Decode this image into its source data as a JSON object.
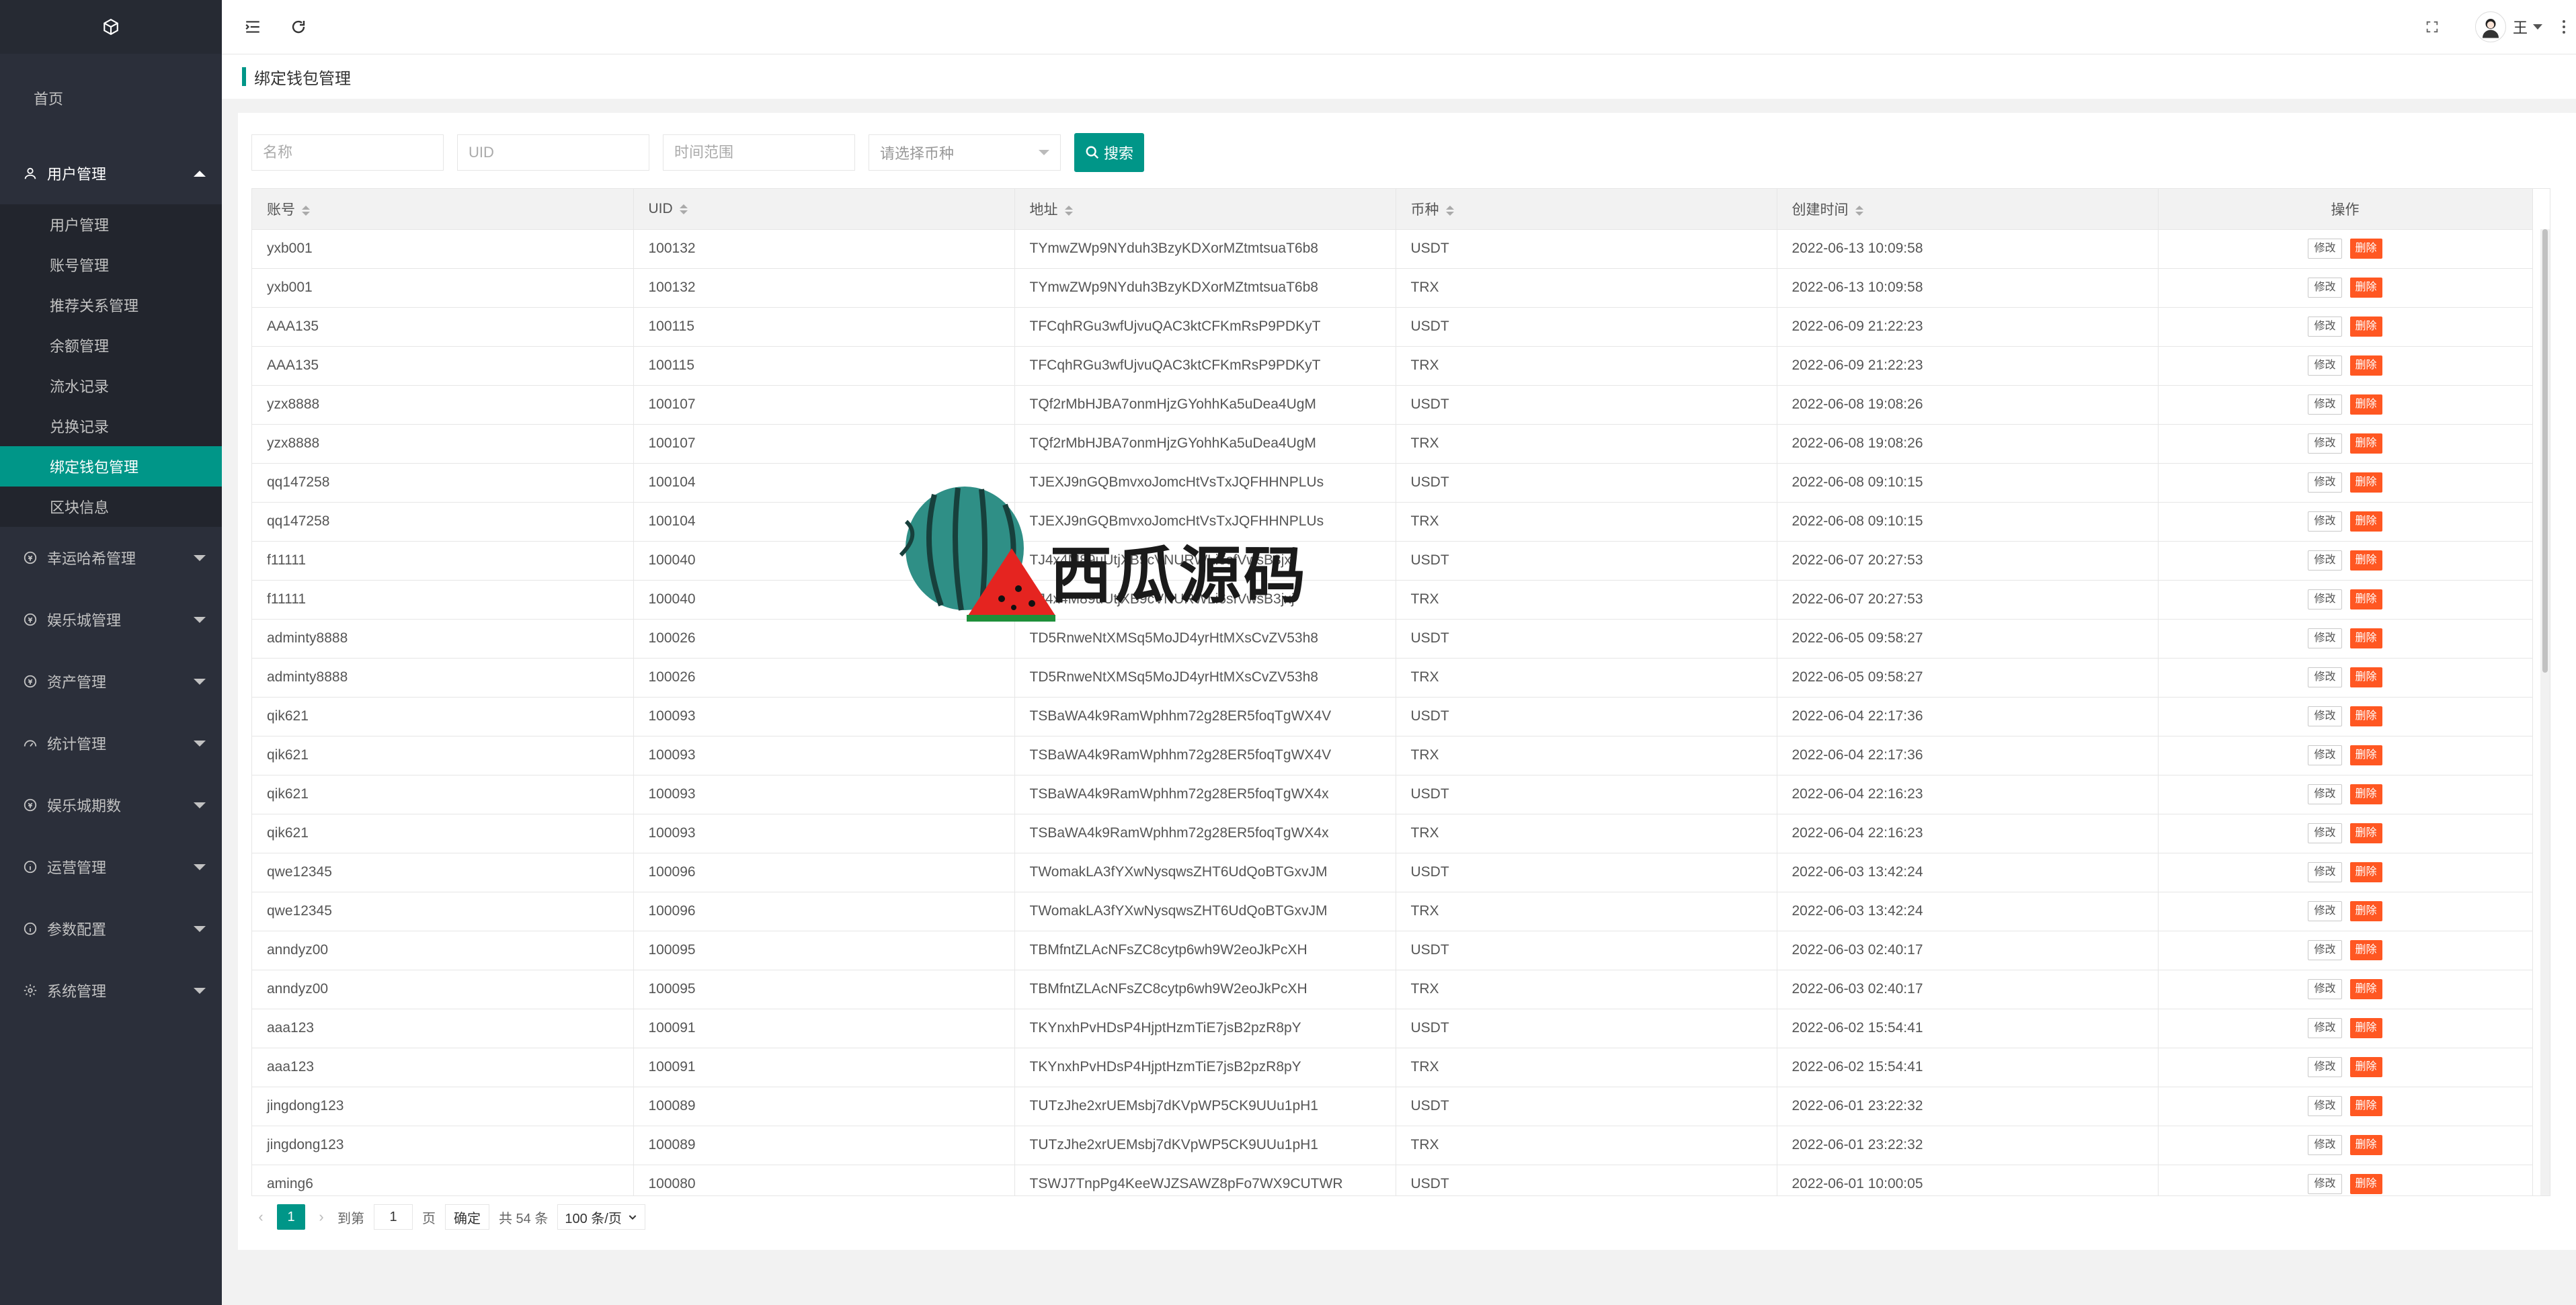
{
  "sidebar": {
    "home": "首页",
    "groups": [
      {
        "label": "用户管理",
        "icon": "user-icon",
        "open": true,
        "children": [
          "用户管理",
          "账号管理",
          "推荐关系管理",
          "余额管理",
          "流水记录",
          "兑换记录",
          "绑定钱包管理",
          "区块信息"
        ]
      },
      {
        "label": "幸运哈希管理",
        "icon": "coin-icon"
      },
      {
        "label": "娱乐城管理",
        "icon": "coin-icon"
      },
      {
        "label": "资产管理",
        "icon": "coin-icon"
      },
      {
        "label": "统计管理",
        "icon": "gauge-icon"
      },
      {
        "label": "娱乐城期数",
        "icon": "coin-icon"
      },
      {
        "label": "运营管理",
        "icon": "info-icon"
      },
      {
        "label": "参数配置",
        "icon": "info-icon"
      },
      {
        "label": "系统管理",
        "icon": "gear-icon"
      }
    ],
    "active_child": "绑定钱包管理"
  },
  "header": {
    "user_name": "王"
  },
  "page": {
    "title": "绑定钱包管理"
  },
  "filters": {
    "name_placeholder": "名称",
    "uid_placeholder": "UID",
    "time_placeholder": "时间范围",
    "coin_placeholder": "请选择币种",
    "search_label": "搜索"
  },
  "table": {
    "columns": [
      "账号",
      "UID",
      "地址",
      "币种",
      "创建时间",
      "操作"
    ],
    "edit_label": "修改",
    "delete_label": "删除",
    "rows": [
      [
        "yxb001",
        "100132",
        "TYmwZWp9NYduh3BzyKDXorMZtmtsuaT6b8",
        "USDT",
        "2022-06-13 10:09:58"
      ],
      [
        "yxb001",
        "100132",
        "TYmwZWp9NYduh3BzyKDXorMZtmtsuaT6b8",
        "TRX",
        "2022-06-13 10:09:58"
      ],
      [
        "AAA135",
        "100115",
        "TFCqhRGu3wfUjvuQAC3ktCFKmRsP9PDKyT",
        "USDT",
        "2022-06-09 21:22:23"
      ],
      [
        "AAA135",
        "100115",
        "TFCqhRGu3wfUjvuQAC3ktCFKmRsP9PDKyT",
        "TRX",
        "2022-06-09 21:22:23"
      ],
      [
        "yzx8888",
        "100107",
        "TQf2rMbHJBA7onmHjzGYohhKa5uDea4UgM",
        "USDT",
        "2022-06-08 19:08:26"
      ],
      [
        "yzx8888",
        "100107",
        "TQf2rMbHJBA7onmHjzGYohhKa5uDea4UgM",
        "TRX",
        "2022-06-08 19:08:26"
      ],
      [
        "qq147258",
        "100104",
        "TJEXJ9nGQBmvxoJomcHtVsTxJQFHHNPLUs",
        "USDT",
        "2022-06-08 09:10:15"
      ],
      [
        "qq147258",
        "100104",
        "TJEXJ9nGQBmvxoJomcHtVsTxJQFHHNPLUs",
        "TRX",
        "2022-06-08 09:10:15"
      ],
      [
        "f11111",
        "100040",
        "TJ4x4M89uUtjXB9cVNURWLi6sfVwsB3jxj",
        "USDT",
        "2022-06-07 20:27:53"
      ],
      [
        "f11111",
        "100040",
        "TJ4x4M89uUtjXB9cVNURWLi6sfVwsB3jxj",
        "TRX",
        "2022-06-07 20:27:53"
      ],
      [
        "adminty8888",
        "100026",
        "TD5RnweNtXMSq5MoJD4yrHtMXsCvZV53h8",
        "USDT",
        "2022-06-05 09:58:27"
      ],
      [
        "adminty8888",
        "100026",
        "TD5RnweNtXMSq5MoJD4yrHtMXsCvZV53h8",
        "TRX",
        "2022-06-05 09:58:27"
      ],
      [
        "qik621",
        "100093",
        "TSBaWA4k9RamWphhm72g28ER5foqTgWX4V",
        "USDT",
        "2022-06-04 22:17:36"
      ],
      [
        "qik621",
        "100093",
        "TSBaWA4k9RamWphhm72g28ER5foqTgWX4V",
        "TRX",
        "2022-06-04 22:17:36"
      ],
      [
        "qik621",
        "100093",
        "TSBaWA4k9RamWphhm72g28ER5foqTgWX4x",
        "USDT",
        "2022-06-04 22:16:23"
      ],
      [
        "qik621",
        "100093",
        "TSBaWA4k9RamWphhm72g28ER5foqTgWX4x",
        "TRX",
        "2022-06-04 22:16:23"
      ],
      [
        "qwe12345",
        "100096",
        "TWomakLA3fYXwNysqwsZHT6UdQoBTGxvJM",
        "USDT",
        "2022-06-03 13:42:24"
      ],
      [
        "qwe12345",
        "100096",
        "TWomakLA3fYXwNysqwsZHT6UdQoBTGxvJM",
        "TRX",
        "2022-06-03 13:42:24"
      ],
      [
        "anndyz00",
        "100095",
        "TBMfntZLAcNFsZC8cytp6wh9W2eoJkPcXH",
        "USDT",
        "2022-06-03 02:40:17"
      ],
      [
        "anndyz00",
        "100095",
        "TBMfntZLAcNFsZC8cytp6wh9W2eoJkPcXH",
        "TRX",
        "2022-06-03 02:40:17"
      ],
      [
        "aaa123",
        "100091",
        "TKYnxhPvHDsP4HjptHzmTiE7jsB2pzR8pY",
        "USDT",
        "2022-06-02 15:54:41"
      ],
      [
        "aaa123",
        "100091",
        "TKYnxhPvHDsP4HjptHzmTiE7jsB2pzR8pY",
        "TRX",
        "2022-06-02 15:54:41"
      ],
      [
        "jingdong123",
        "100089",
        "TUTzJhe2xrUEMsbj7dKVpWP5CK9UUu1pH1",
        "USDT",
        "2022-06-01 23:22:32"
      ],
      [
        "jingdong123",
        "100089",
        "TUTzJhe2xrUEMsbj7dKVpWP5CK9UUu1pH1",
        "TRX",
        "2022-06-01 23:22:32"
      ],
      [
        "aming6",
        "100080",
        "TSWJ7TnpPg4KeeWJZSAWZ8pFo7WX9CUTWR",
        "USDT",
        "2022-06-01 10:00:05"
      ]
    ]
  },
  "pager": {
    "current": "1",
    "goto_label": "到第",
    "page_input": "1",
    "page_unit": "页",
    "confirm_label": "确定",
    "total_label": "共 54 条",
    "page_size": "100 条/页"
  },
  "watermark": {
    "text": "西瓜源码"
  },
  "colors": {
    "accent": "#009688",
    "sidebar_bg": "#2b2f3a",
    "danger": "#ff5722"
  }
}
